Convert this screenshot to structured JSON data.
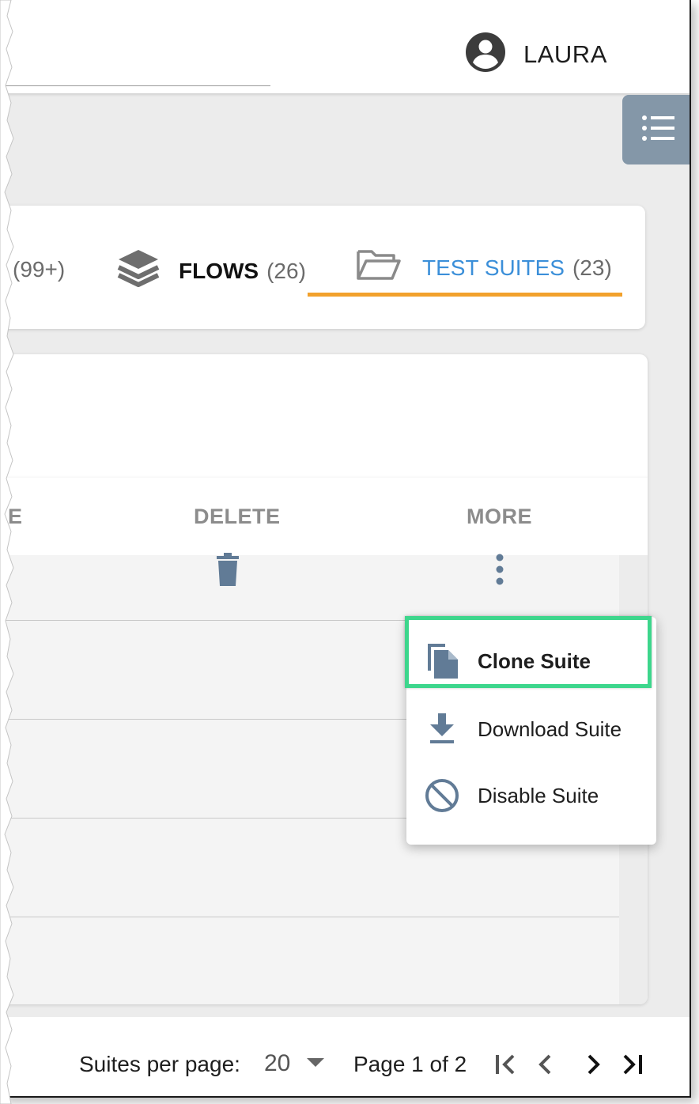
{
  "header": {
    "user_name": "LAURA",
    "user_icon": "account-circle-icon",
    "list_icon": "list-icon"
  },
  "tabs": [
    {
      "label": "",
      "count": "(99+)",
      "icon": "partial-tab-icon"
    },
    {
      "label": "FLOWS",
      "count": "(26)",
      "icon": "layers-icon"
    },
    {
      "label": "TEST SUITES",
      "count": "(23)",
      "icon": "folder-open-icon",
      "active": true
    }
  ],
  "table": {
    "columns": [
      "E",
      "DELETE",
      "MORE"
    ]
  },
  "context_menu": {
    "items": [
      {
        "label": "Clone Suite",
        "icon": "clone-icon",
        "highlighted": true
      },
      {
        "label": "Download Suite",
        "icon": "download-icon"
      },
      {
        "label": "Disable Suite",
        "icon": "block-icon"
      }
    ]
  },
  "footer": {
    "per_page_label": "Suites per page:",
    "per_page_value": "20",
    "page_info": "Page 1 of 2"
  },
  "colors": {
    "accent_blue": "#3b8fd9",
    "tab_underline": "#f2a12c",
    "icon_slate": "#617b96",
    "highlight_green": "#3dd68c",
    "toggle_bg": "#8497a8"
  }
}
